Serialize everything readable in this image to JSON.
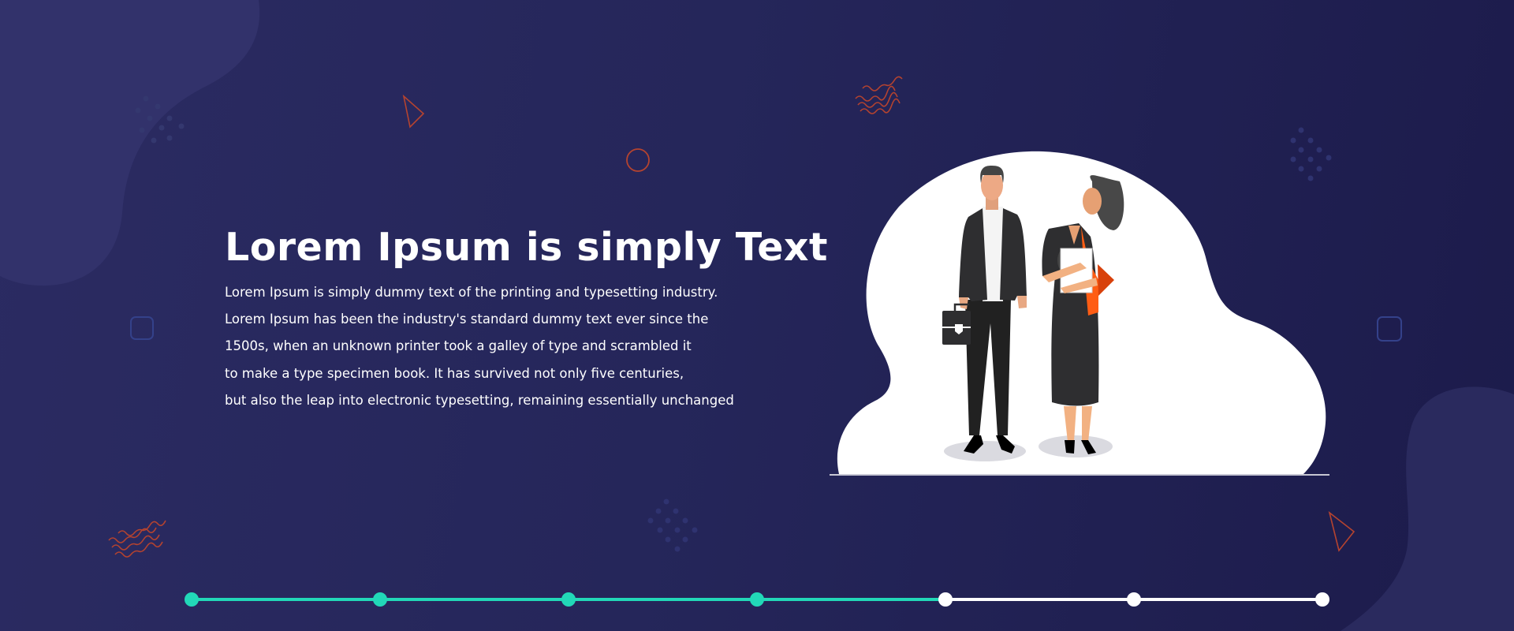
{
  "hero": {
    "title": "Lorem Ipsum is simply Text",
    "lines": [
      "Lorem Ipsum is simply dummy text of the printing and typesetting industry.",
      "Lorem Ipsum has been the industry's standard dummy text ever since the",
      "1500s, when an unknown printer took a galley of type and scrambled it",
      "to make a type specimen book. It has survived not only five centuries,",
      "but also the leap into electronic typesetting, remaining essentially unchanged"
    ]
  },
  "stepper": {
    "total_steps": 7,
    "completed_steps": 5,
    "active_color": "#22d8b8",
    "inactive_color": "#ffffff"
  },
  "colors": {
    "background": "#25265a",
    "accent_decor": "#c0392b",
    "illustration_blob": "#ffffff"
  }
}
